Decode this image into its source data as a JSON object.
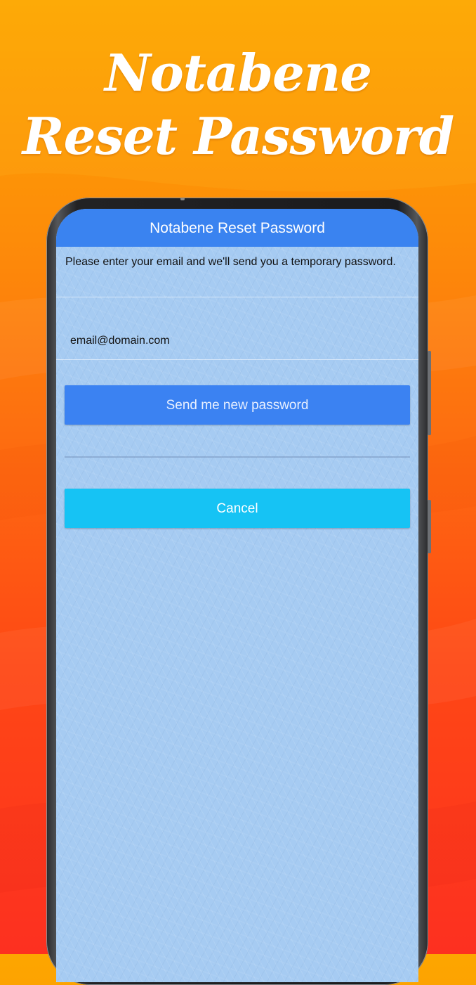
{
  "promo": {
    "headline_line1": "Notabene",
    "headline_line2": "Reset Password"
  },
  "screen": {
    "nav_title": "Notabene Reset Password",
    "intro_text": "Please enter your email and we'll send you a temporary password.",
    "email_field": {
      "value": "email@domain.com",
      "placeholder": ""
    },
    "send_button_label": "Send me new password",
    "cancel_button_label": "Cancel"
  },
  "colors": {
    "navbar": "#3a83f0",
    "send_button": "#3b82f2",
    "cancel_button": "#16c3f4",
    "screen_background": "#a6cbf2",
    "promo_gradient_top": "#fda600",
    "promo_gradient_bottom": "#fd3020"
  }
}
